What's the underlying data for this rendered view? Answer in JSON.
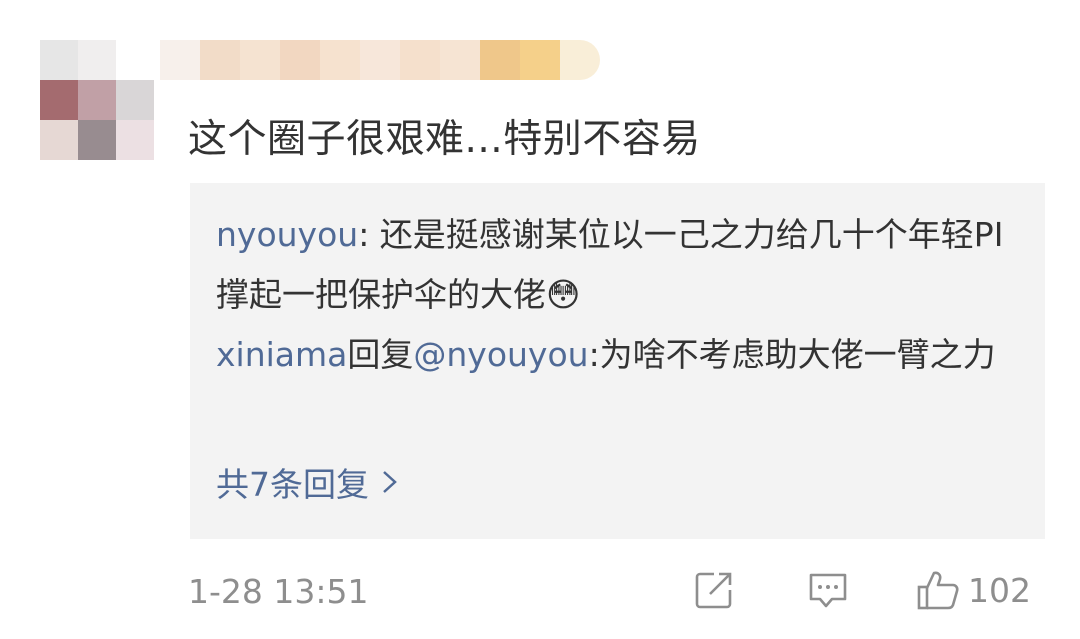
{
  "comment": {
    "text": "这个圈子很艰难...特别不容易"
  },
  "replies": [
    {
      "user": "nyouyou",
      "separator": ": ",
      "text": "还是挺感谢某位以一己之力给几十个年轻PI撑起一把保护伞的大佬😳"
    },
    {
      "user": "xiniama",
      "middle": "回复",
      "mention": "@nyouyou",
      "text": ":为啥不考虑助大佬一臂之力"
    }
  ],
  "more_replies_label": "共7条回复",
  "meta": {
    "timestamp": "1-28 13:51",
    "like_count": "102"
  },
  "icons": {
    "forward": "share-forward-icon",
    "comment": "comment-bubble-icon",
    "like": "thumbs-up-icon",
    "more": "chevron-right-icon"
  },
  "colors": {
    "link": "#506a96",
    "text": "#333333",
    "meta": "#8e8e8e",
    "reply_bg": "#f3f3f3"
  }
}
